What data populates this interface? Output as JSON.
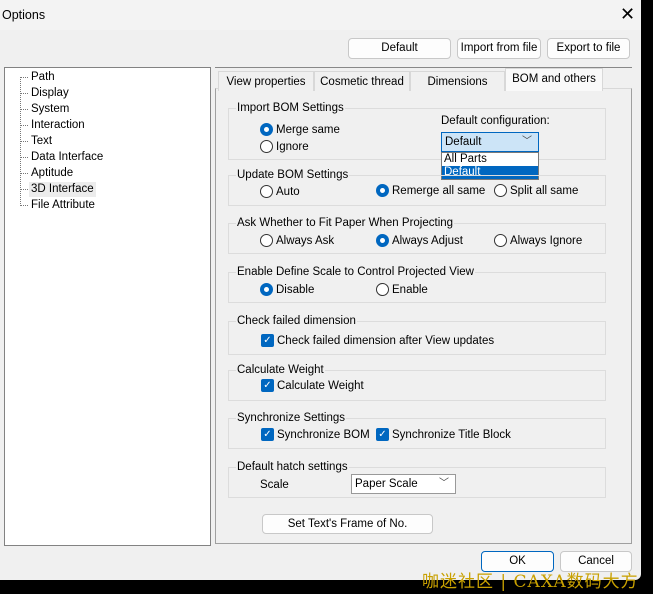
{
  "window": {
    "title": "Options"
  },
  "toolbar": {
    "default": "Default",
    "import": "Import from file",
    "export": "Export to file"
  },
  "tree": [
    "Path",
    "Display",
    "System",
    "Interaction",
    "Text",
    "Data Interface",
    "Aptitude",
    "3D Interface",
    "File Attribute"
  ],
  "tree_selected": "3D Interface",
  "tabs": [
    "View properties",
    "Cosmetic thread",
    "Dimensions",
    "BOM and others"
  ],
  "active_tab": "BOM and others",
  "import_bom": {
    "title": "Import BOM Settings",
    "merge": "Merge same",
    "ignore": "Ignore",
    "config_label": "Default configuration:",
    "config_value": "Default",
    "options": [
      "All Parts",
      "Default"
    ]
  },
  "update_bom": {
    "title": "Update BOM Settings",
    "auto": "Auto",
    "remerge": "Remerge all same",
    "split": "Split all same"
  },
  "fit_paper": {
    "title": "Ask Whether to Fit Paper When Projecting",
    "ask": "Always Ask",
    "adjust": "Always Adjust",
    "ignore": "Always Ignore"
  },
  "scale_ctrl": {
    "title": "Enable Define Scale to Control Projected View",
    "disable": "Disable",
    "enable": "Enable"
  },
  "check_dim": {
    "title": "Check failed dimension",
    "label": "Check failed dimension after View updates"
  },
  "weight": {
    "title": "Calculate Weight",
    "label": "Calculate Weight"
  },
  "sync": {
    "title": "Synchronize Settings",
    "bom": "Synchronize BOM",
    "title_block": "Synchronize Title Block"
  },
  "hatch": {
    "title": "Default hatch settings",
    "scale_label": "Scale",
    "scale_value": "Paper Scale"
  },
  "frame_button": "Set Text's Frame of No.",
  "footer": {
    "ok": "OK",
    "cancel": "Cancel"
  },
  "watermark": "咖迷社区 | CAXA数码大方"
}
